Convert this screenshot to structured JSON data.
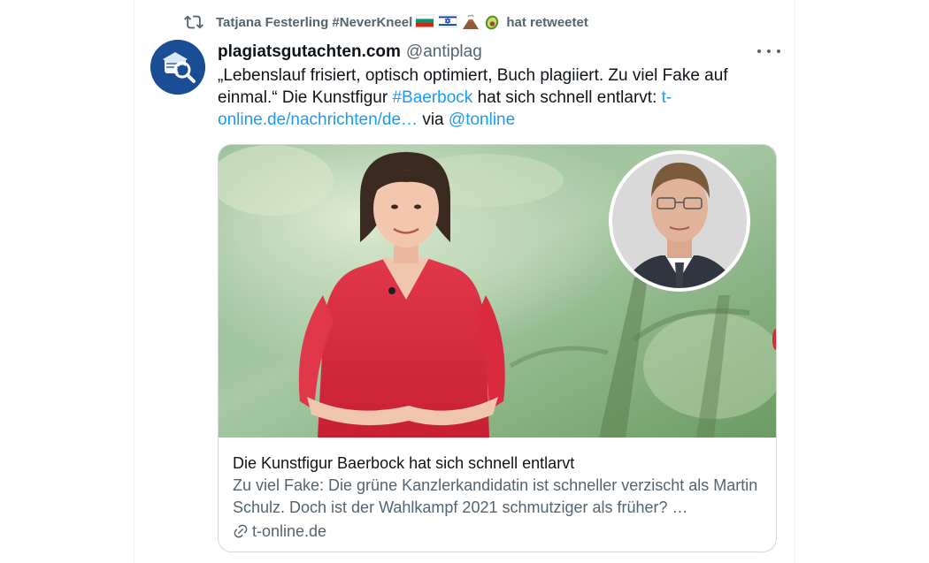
{
  "retweet": {
    "icon": "retweet-icon",
    "user": "Tatjana Festerling #NeverKneel",
    "emojis": [
      "bulgaria-flag",
      "israel-flag",
      "volcano-icon",
      "avocado-icon"
    ],
    "action": "hat retweetet"
  },
  "tweet": {
    "name": "plagiatsgutachten.com",
    "handle": "@antiplag",
    "text_part1": "„Lebenslauf frisiert, optisch optimiert, Buch plagiiert. Zu viel Fake auf einmal.“ Die Kunstfigur ",
    "hashtag": "#Baerbock",
    "text_part2": " hat sich schnell entlarvt: ",
    "url": "t-online.de/nachrichten/de…",
    "text_part3": " via ",
    "mention": "@tonline"
  },
  "card": {
    "title": "Die Kunstfigur Baerbock hat sich schnell entlarvt",
    "description": "Zu viel Fake: Die grüne Kanzlerkandidatin ist schneller verzischt als Martin Schulz. Doch ist der Wahlkampf 2021 schmutziger als früher? …",
    "domain": "t-online.de"
  },
  "colors": {
    "text": "#0f1419",
    "secondary": "#536471",
    "link": "#1d9bf0",
    "border": "#cfd9de",
    "dress": "#d8263e",
    "avatar": "#1a4d93"
  }
}
